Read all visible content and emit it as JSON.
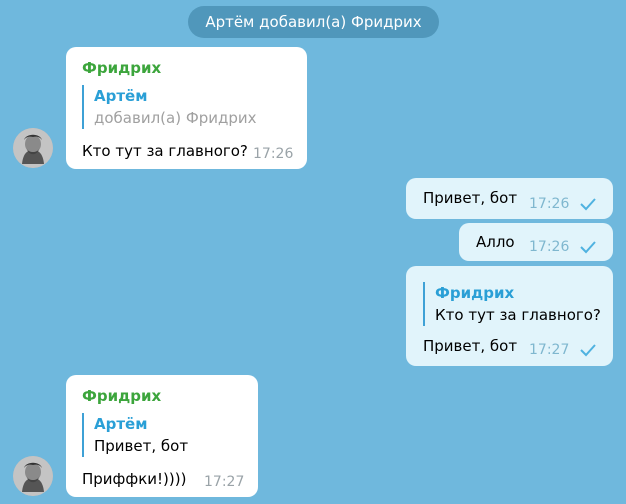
{
  "service_message": "Артём добавил(а) Фридрих",
  "messages": [
    {
      "sender": "Фридрих",
      "reply_name": "Артём",
      "reply_text": "добавил(а) Фридрих",
      "text": "Кто тут за главного?",
      "time": "17:26"
    },
    {
      "text": "Привет, бот",
      "time": "17:26"
    },
    {
      "text": "Алло",
      "time": "17:26"
    },
    {
      "reply_name": "Фридрих",
      "reply_text": "Кто тут за главного?",
      "text": "Привет, бот",
      "time": "17:27"
    },
    {
      "sender": "Фридрих",
      "reply_name": "Артём",
      "reply_text": "Привет, бот",
      "text": "Приффки!))))",
      "time": "17:27"
    }
  ],
  "icons": {
    "avatar": "avatar-icon",
    "check": "check-icon"
  },
  "colors": {
    "background": "#6fb8dd",
    "incoming": "#ffffff",
    "outgoing": "#e1f4fb",
    "sender": "#3ca53c",
    "reply": "#2a9fd6"
  }
}
